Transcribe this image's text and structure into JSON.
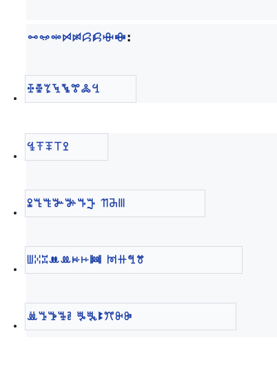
{
  "heading": {
    "text": "ꗬꗭꗮꗯꗰꗱꗲꗳꗴ",
    "colon": ":"
  },
  "links": [
    {
      "label": "ꔀꔁꔂꔃꔄꔅꔆꔇ"
    },
    {
      "label": "ꔈꔉꔊꔋꔌ"
    },
    {
      "label": "ꔍꔎꔏꔐꔑꔒꔓ ꔔꔕꔖ"
    },
    {
      "label": "ꔗꔘꔙꔚꔛꔜꔝꔞ ꔟꔠꔡꔢ"
    },
    {
      "label": "ꔣꔤꔥꔦꔧ ꔨꔩꔪꔫꔬꔭ"
    }
  ]
}
